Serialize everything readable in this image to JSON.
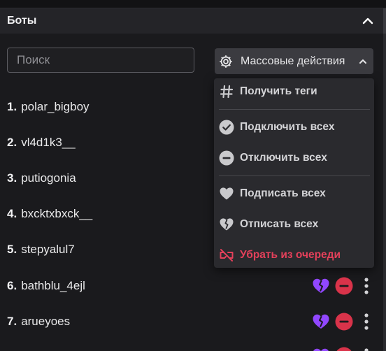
{
  "panel": {
    "title": "Боты"
  },
  "search": {
    "placeholder": "Поиск",
    "value": ""
  },
  "bulk_actions": {
    "label": "Массовые действия",
    "menu": [
      {
        "id": "get-tags",
        "label": "Получить теги",
        "icon": "hash-icon"
      },
      {
        "id": "connect-all",
        "label": "Подключить всех",
        "icon": "check-circle-icon"
      },
      {
        "id": "disconnect-all",
        "label": "Отключить всех",
        "icon": "minus-circle-icon"
      },
      {
        "id": "subscribe-all",
        "label": "Подписать всех",
        "icon": "heart-icon"
      },
      {
        "id": "unsubscribe-all",
        "label": "Отписать всех",
        "icon": "broken-heart-icon"
      },
      {
        "id": "remove-from-queue",
        "label": "Убрать из очереди",
        "icon": "unlink-icon",
        "color": "#e3405a"
      }
    ]
  },
  "bots": [
    {
      "num": "1.",
      "name": "polar_bigboy"
    },
    {
      "num": "2.",
      "name": "vl4d1k3__"
    },
    {
      "num": "3.",
      "name": "putiogonia"
    },
    {
      "num": "4.",
      "name": "bxcktxbxck__"
    },
    {
      "num": "5.",
      "name": "stepyalul7"
    },
    {
      "num": "6.",
      "name": "bathblu_4ejl"
    },
    {
      "num": "7.",
      "name": "arueyoes"
    }
  ],
  "colors": {
    "background": "#1a1a1d",
    "header": "#242428",
    "menu": "#2a2a2e",
    "accent_purple": "#9147ff",
    "danger_red": "#e3405a",
    "minus_red": "#d9334a"
  }
}
